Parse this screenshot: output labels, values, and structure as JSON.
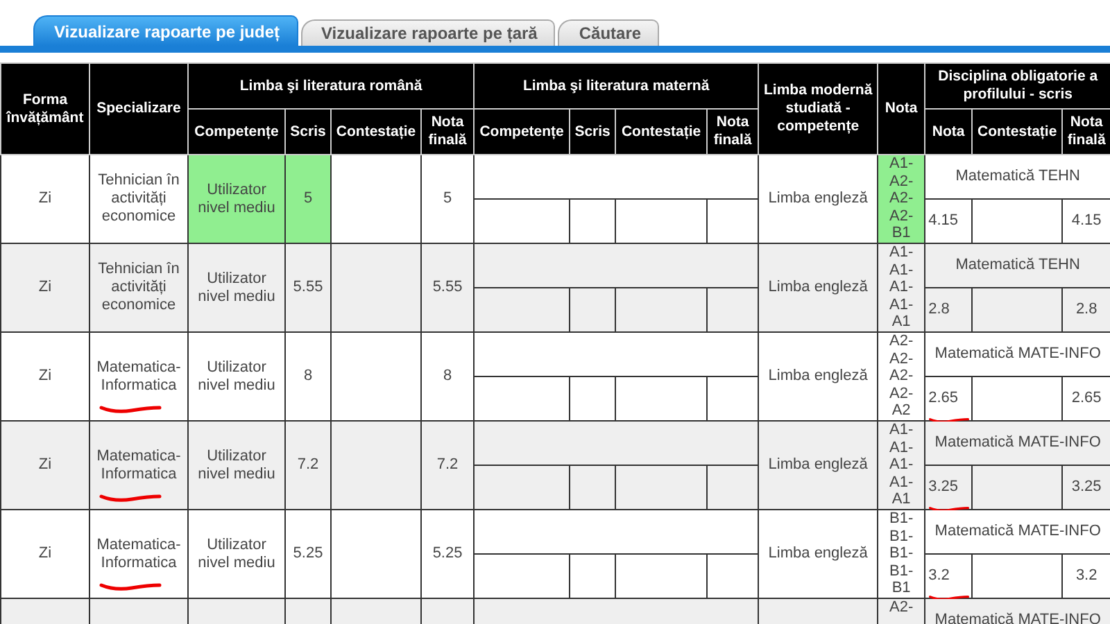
{
  "tabs": [
    {
      "label": "Vizualizare rapoarte pe județ",
      "selected": true
    },
    {
      "label": "Vizualizare rapoarte pe țară",
      "selected": false
    },
    {
      "label": "Căutare",
      "selected": false
    }
  ],
  "table": {
    "header_top": [
      "Forma învățământ",
      "Specializare",
      "Limba şi literatura română",
      "Limba şi literatura maternă",
      "Limba modernă studiată - competențe",
      "Nota",
      "Disciplina obligatorie a profilului - scris"
    ],
    "header_sub": [
      "Competențe",
      "Scris",
      "Contestație",
      "Nota finală",
      "Competențe",
      "Scris",
      "Contestație",
      "Nota finală",
      "Nota",
      "Contestație",
      "Nota finală"
    ],
    "rows": [
      {
        "forma": "Zi",
        "specializare": "Tehnician în activități economice",
        "ro_competente": {
          "text": "Utilizator nivel mediu",
          "highlighted": true
        },
        "ro_scris": {
          "text": "5",
          "highlighted": true
        },
        "ro_finala": "5",
        "moderna": "Limba engleză",
        "nota": {
          "text": "A1-A2-A2-A2-B1",
          "highlighted": true
        },
        "profil_disciplina": "Matematică TEHN",
        "profil_nota": "4.15",
        "profil_finala": "4.15",
        "underlined": false
      },
      {
        "forma": "Zi",
        "specializare": "Tehnician în activități economice",
        "ro_competente": {
          "text": "Utilizator nivel mediu",
          "highlighted": false
        },
        "ro_scris": {
          "text": "5.55",
          "highlighted": false
        },
        "ro_finala": "5.55",
        "moderna": "Limba engleză",
        "nota": {
          "text": "A1-A1-A1-A1-A1",
          "highlighted": false
        },
        "profil_disciplina": "Matematică TEHN",
        "profil_nota": "2.8",
        "profil_finala": "2.8",
        "underlined": false
      },
      {
        "forma": "Zi",
        "specializare": "Matematica-Informatica",
        "ro_competente": {
          "text": "Utilizator nivel mediu",
          "highlighted": false
        },
        "ro_scris": {
          "text": "8",
          "highlighted": false
        },
        "ro_finala": "8",
        "moderna": "Limba engleză",
        "nota": {
          "text": "A2-A2-A2-A2-A2",
          "highlighted": false
        },
        "profil_disciplina": "Matematică MATE-INFO",
        "profil_nota": "2.65",
        "profil_finala": "2.65",
        "underlined": true
      },
      {
        "forma": "Zi",
        "specializare": "Matematica-Informatica",
        "ro_competente": {
          "text": "Utilizator nivel mediu",
          "highlighted": false
        },
        "ro_scris": {
          "text": "7.2",
          "highlighted": false
        },
        "ro_finala": "7.2",
        "moderna": "Limba engleză",
        "nota": {
          "text": "A1-A1-A1-A1-A1",
          "highlighted": false
        },
        "profil_disciplina": "Matematică MATE-INFO",
        "profil_nota": "3.25",
        "profil_finala": "3.25",
        "underlined": true
      },
      {
        "forma": "Zi",
        "specializare": "Matematica-Informatica",
        "ro_competente": {
          "text": "Utilizator nivel mediu",
          "highlighted": false
        },
        "ro_scris": {
          "text": "5.25",
          "highlighted": false
        },
        "ro_finala": "5.25",
        "moderna": "Limba engleză",
        "nota": {
          "text": "B1-B1-B1-B1-B1",
          "highlighted": false
        },
        "profil_disciplina": "Matematică MATE-INFO",
        "profil_nota": "3.2",
        "profil_finala": "3.2",
        "underlined": true
      },
      {
        "nota": {
          "text": "A2-",
          "highlighted": false
        },
        "profil_disciplina": "Matematică MATE-INFO",
        "underlined": false
      }
    ]
  }
}
